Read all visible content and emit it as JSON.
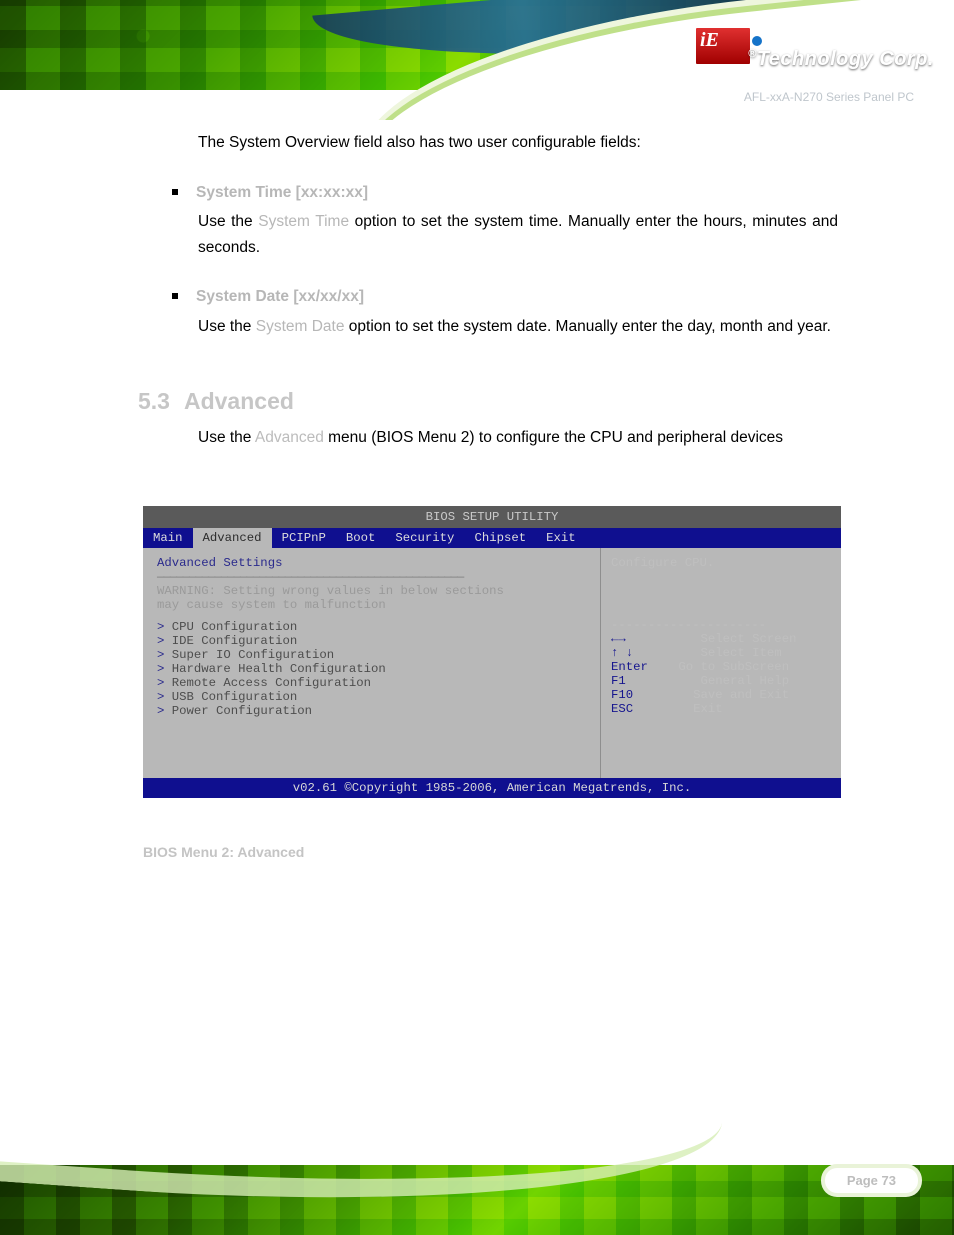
{
  "header": {
    "brand_reg": "®",
    "brand": "Technology Corp.",
    "doc_title": "AFL-xxA-N270 Series Panel PC"
  },
  "body": {
    "intro": "The System Overview field also has two user configurable fields:",
    "bullets": [
      {
        "label": "System Time [xx:xx:xx]",
        "pre": "Use the ",
        "field": "System Time",
        "post": " option to set the system time. Manually enter the hours, minutes and seconds."
      },
      {
        "label": "System Date [xx/xx/xx]",
        "pre": "Use the ",
        "field": "System Date",
        "post": " option to set the system date. Manually enter the day, month and year."
      }
    ],
    "section": {
      "num": "5.3",
      "title": "Advanced"
    },
    "adv_pre": "Use the ",
    "adv_field": "Advanced",
    "adv_post": " menu (BIOS Menu 2) to configure the CPU and peripheral devices"
  },
  "bios": {
    "topbar": "BIOS SETUP UTILITY",
    "tabs": [
      "Main",
      "Advanced",
      "PCIPnP",
      "Boot",
      "Security",
      "Chipset",
      "Exit"
    ],
    "selected_tab": 1,
    "left": {
      "heading": "Advanced Settings",
      "warning1": "WARNING: Setting wrong values in below sections",
      "warning2": "         may cause system to malfunction",
      "items": [
        "CPU Configuration",
        "IDE Configuration",
        "Super IO Configuration",
        "Hardware Health Configuration",
        "Remote Access Configuration",
        "USB Configuration",
        "Power Configuration"
      ]
    },
    "right": {
      "hint": "Configure CPU.\n\n\n\n",
      "rule": "---------------------",
      "keys": [
        {
          "k": "←→",
          "d": "    Select Screen"
        },
        {
          "k": "↑ ↓",
          "d": "    Select Item"
        },
        {
          "k": "Enter",
          "d": " Go to SubScreen"
        },
        {
          "k": "F1",
          "d": "    General Help"
        },
        {
          "k": "F10",
          "d": "   Save and Exit"
        },
        {
          "k": "ESC",
          "d": "   Exit"
        }
      ]
    },
    "footer": "v02.61 ©Copyright 1985-2006, American Megatrends, Inc.",
    "caption": "BIOS Menu 2: Advanced"
  },
  "footer": {
    "page": "Page 73"
  }
}
